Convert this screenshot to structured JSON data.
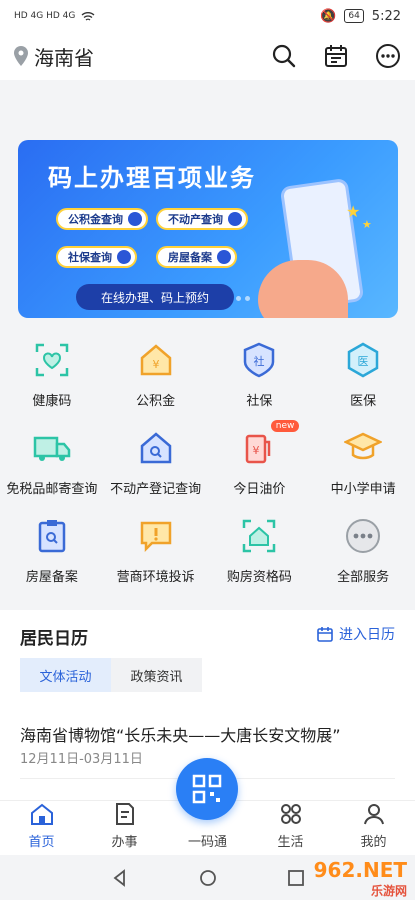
{
  "status_bar": {
    "left": "HD 4G HD 4G",
    "battery": "64",
    "time": "5:22"
  },
  "header": {
    "location": "海南省"
  },
  "banner": {
    "title": "码上办理百项业务",
    "chips": [
      "公积金查询",
      "不动产查询",
      "社保查询",
      "房屋备案"
    ],
    "pill": "在线办理、码上预约"
  },
  "services": [
    {
      "label": "健康码",
      "icon": "health-code-icon",
      "color": "#2cc4a6"
    },
    {
      "label": "公积金",
      "icon": "fund-house-icon",
      "color": "#f0a22a"
    },
    {
      "label": "社保",
      "icon": "social-security-icon",
      "color": "#3a6ad6"
    },
    {
      "label": "医保",
      "icon": "medical-insurance-icon",
      "color": "#2ba7d8"
    },
    {
      "label": "免税品邮寄查询",
      "icon": "delivery-truck-icon",
      "color": "#2cc4a6"
    },
    {
      "label": "不动产登记查询",
      "icon": "house-search-icon",
      "color": "#3a6ad6"
    },
    {
      "label": "今日油价",
      "icon": "fuel-pump-icon",
      "color": "#e8544a",
      "badge": "new"
    },
    {
      "label": "中小学申请",
      "icon": "graduation-cap-icon",
      "color": "#f0a22a"
    },
    {
      "label": "房屋备案",
      "icon": "clipboard-search-icon",
      "color": "#3a6ad6"
    },
    {
      "label": "营商环境投诉",
      "icon": "complaint-icon",
      "color": "#f0a22a"
    },
    {
      "label": "购房资格码",
      "icon": "house-scan-icon",
      "color": "#2cc4a6"
    },
    {
      "label": "全部服务",
      "icon": "more-dots-icon",
      "color": "#9aa0a6"
    }
  ],
  "calendar": {
    "title": "居民日历",
    "link": "进入日历",
    "tabs": [
      "文体活动",
      "政策资讯"
    ],
    "news_title": "海南省博物馆“长乐未央——大唐长安文物展”",
    "news_date": "12月11日-03月11日"
  },
  "bottom_nav": [
    "首页",
    "办事",
    "一码通",
    "生活",
    "我的"
  ],
  "watermark": {
    "brand": "962.NET",
    "sub": "乐游网"
  }
}
